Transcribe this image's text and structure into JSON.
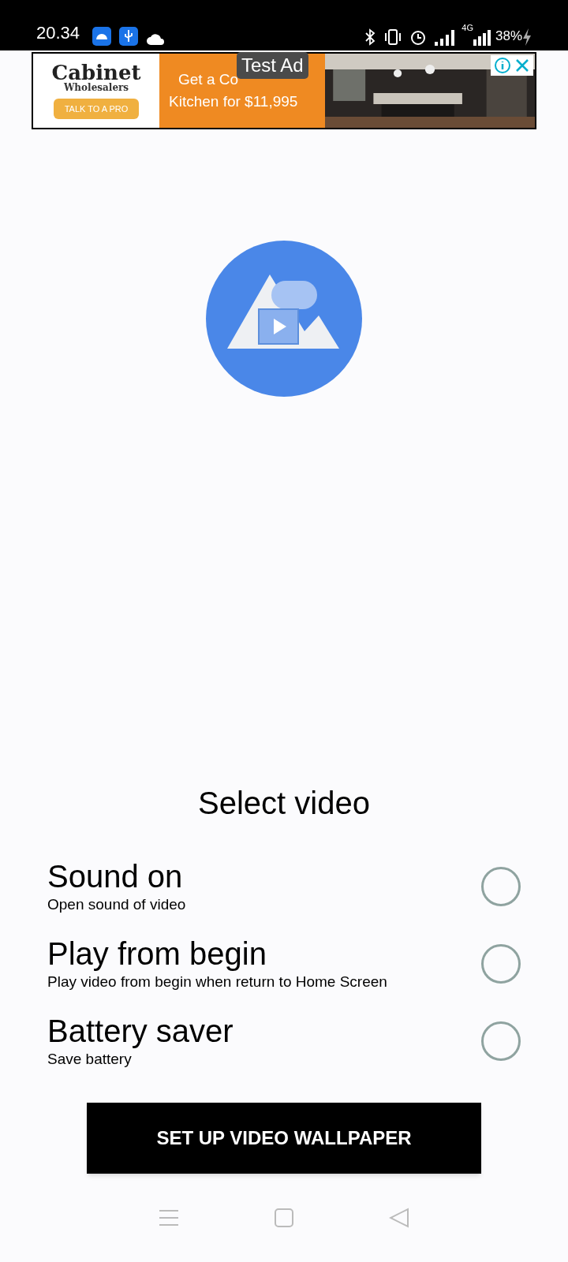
{
  "status_bar": {
    "time": "20.34",
    "battery": "38%",
    "network": "4G"
  },
  "ad": {
    "logo_title": "Cabinet",
    "logo_subtitle": "Wholesalers",
    "cta": "TALK TO A PRO",
    "headline_line_1": "Get a Co",
    "headline_line_2": "Kitchen for $11,995",
    "label": "Test Ad"
  },
  "title": "Select video",
  "options": [
    {
      "title": "Sound on",
      "subtitle": "Open sound of video",
      "checked": false
    },
    {
      "title": "Play from begin",
      "subtitle": "Play video from begin when return to Home Screen",
      "checked": false
    },
    {
      "title": "Battery saver",
      "subtitle": "Save battery",
      "checked": false
    }
  ],
  "button": "SET UP VIDEO WALLPAPER"
}
